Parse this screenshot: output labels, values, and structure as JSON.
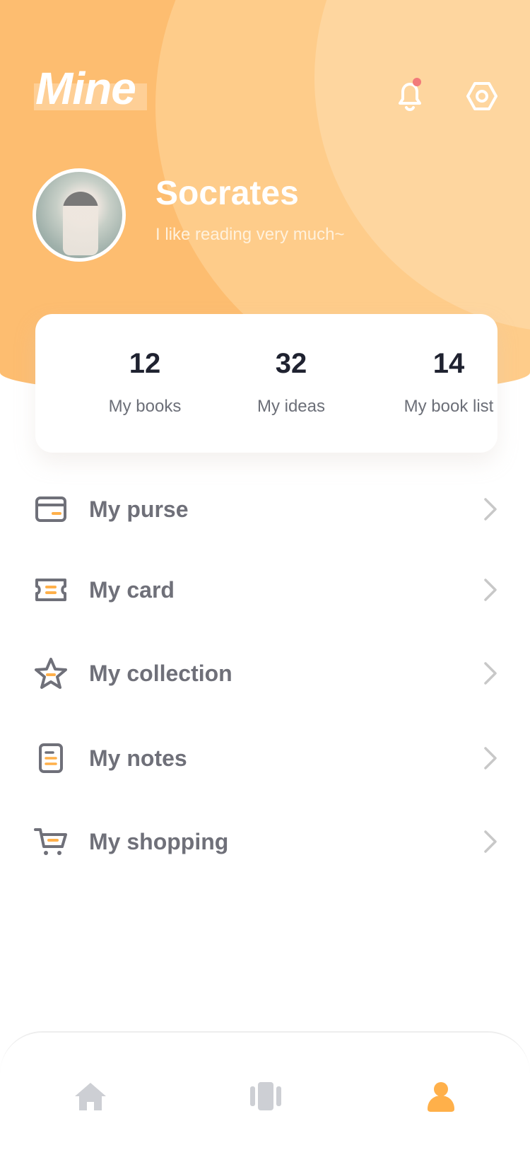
{
  "header": {
    "title": "Mine",
    "notification_icon": "bell-icon",
    "settings_icon": "settings-hexagon-icon",
    "has_unread": true
  },
  "profile": {
    "name": "Socrates",
    "motto": "I like reading very much~"
  },
  "stats": [
    {
      "value": "12",
      "label": "My books"
    },
    {
      "value": "32",
      "label": "My ideas"
    },
    {
      "value": "14",
      "label": "My book list"
    }
  ],
  "menu": [
    {
      "label": "My purse",
      "icon": "wallet-icon"
    },
    {
      "label": "My card",
      "icon": "ticket-icon"
    },
    {
      "label": "My collection",
      "icon": "star-icon"
    },
    {
      "label": "My notes",
      "icon": "note-icon"
    },
    {
      "label": "My shopping",
      "icon": "cart-icon"
    }
  ],
  "tabbar": {
    "items": [
      {
        "icon": "home-icon",
        "active": false
      },
      {
        "icon": "books-icon",
        "active": false
      },
      {
        "icon": "person-icon",
        "active": true
      }
    ]
  },
  "colors": {
    "accent": "#fdbd70",
    "accent_highlight": "#ffb04a",
    "icon_gray": "#6f7079",
    "text_dark": "#1f2230",
    "badge": "#f27a7a"
  }
}
